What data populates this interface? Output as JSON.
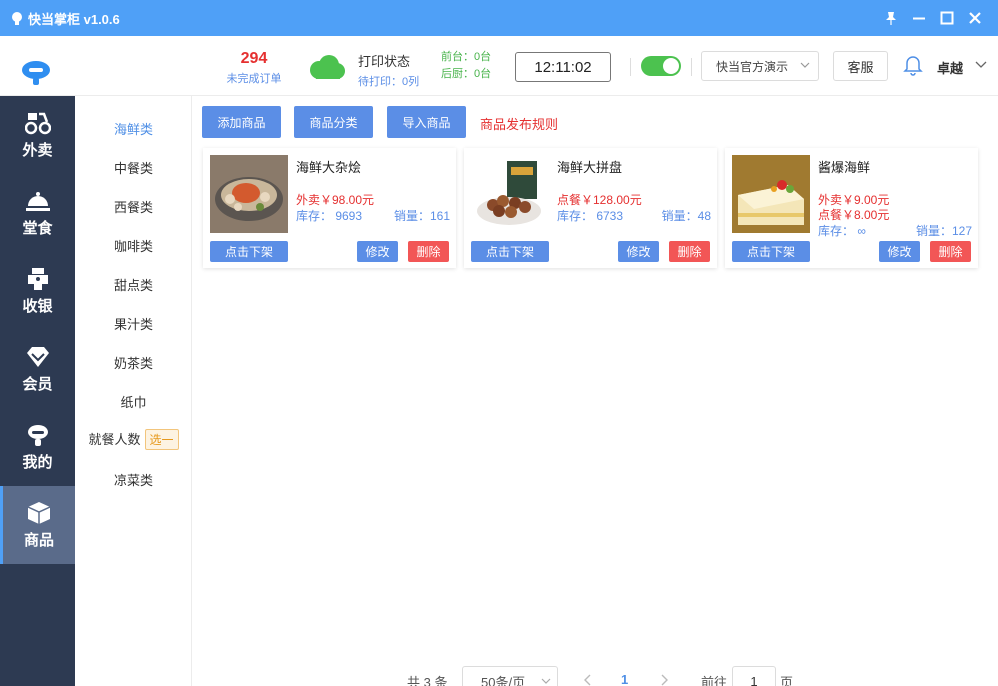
{
  "titlebar": {
    "title": "快当掌柜 v1.0.6",
    "controls": [
      "pin-icon",
      "minimize-icon",
      "maximize-icon",
      "close-icon"
    ],
    "color": "#4fa0f7"
  },
  "header": {
    "orders_count": "294",
    "orders_label": "未完成订单",
    "print_status_title": "打印状态",
    "print_pending": "待打印：0列",
    "front_desk": "前台：0台",
    "kitchen": "后厨：0台",
    "clock": "12:11:02",
    "toggle_on": true,
    "store_name": "快当官方演示",
    "service_label": "客服",
    "user_name": "卓越"
  },
  "nav": {
    "items": [
      {
        "label": "外卖",
        "icon": "delivery-icon",
        "active": false
      },
      {
        "label": "堂食",
        "icon": "dine-in-icon",
        "active": false
      },
      {
        "label": "收银",
        "icon": "cashier-icon",
        "active": false
      },
      {
        "label": "会员",
        "icon": "member-icon",
        "active": false
      },
      {
        "label": "我的",
        "icon": "profile-icon",
        "active": false
      },
      {
        "label": "商品",
        "icon": "product-box-icon",
        "active": true
      }
    ],
    "bg": "#2d3a52",
    "active_bg": "#5a6b8a"
  },
  "categories": {
    "items": [
      {
        "label": "海鲜类",
        "active": true
      },
      {
        "label": "中餐类"
      },
      {
        "label": "西餐类"
      },
      {
        "label": "咖啡类"
      },
      {
        "label": "甜点类"
      },
      {
        "label": "果汁类"
      },
      {
        "label": "奶茶类"
      },
      {
        "label": "纸巾"
      },
      {
        "label": "就餐人数",
        "badge": "选一"
      },
      {
        "label": "凉菜类"
      }
    ]
  },
  "toolbar": {
    "add_product": "添加商品",
    "product_category": "商品分类",
    "import_product": "导入商品",
    "rules_link": "商品发布规则"
  },
  "products": [
    {
      "name": "海鲜大杂烩",
      "prices": [
        "外卖￥98.00元"
      ],
      "stock": "库存： 9693",
      "sales": "销量：161",
      "off_label": "点击下架",
      "edit_label": "修改",
      "delete_label": "删除",
      "image": "seafood-pot-image"
    },
    {
      "name": "海鲜大拼盘",
      "prices": [
        "点餐￥128.00元"
      ],
      "stock": "库存： 6733",
      "sales": "销量：48",
      "off_label": "点击下架",
      "edit_label": "修改",
      "delete_label": "删除",
      "image": "snack-bowl-image"
    },
    {
      "name": "酱爆海鲜",
      "prices": [
        "外卖￥9.00元",
        "点餐￥8.00元"
      ],
      "stock": "库存： ∞",
      "sales": "销量：127",
      "off_label": "点击下架",
      "edit_label": "修改",
      "delete_label": "删除",
      "image": "cake-image"
    }
  ],
  "pagination": {
    "total": "共 3 条",
    "page_size": "50条/页",
    "current_page": "1",
    "goto_label": "前往",
    "goto_value": "1",
    "page_unit": "页"
  }
}
